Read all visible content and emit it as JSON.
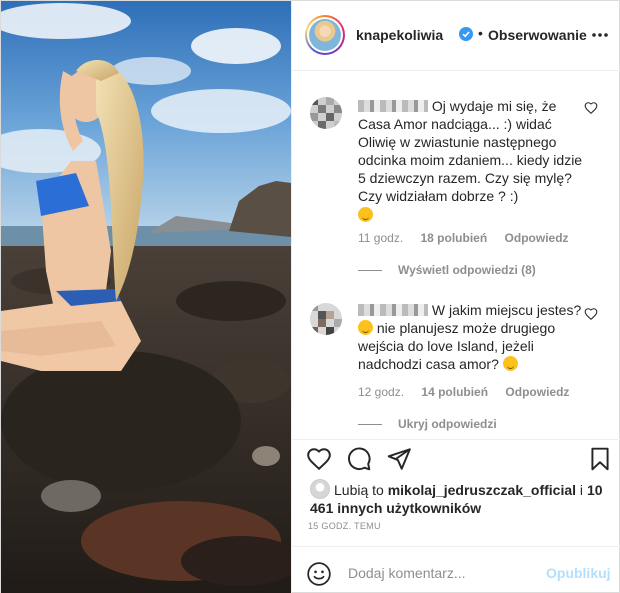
{
  "post": {
    "author": {
      "username": "knapekoliwia",
      "verified": true
    },
    "follow_label": "Obserwowanie",
    "separator": "•"
  },
  "comments": [
    {
      "text": "Oj wydaje mi się, że Casa Amor nadciąga... :) widać Oliwię w zwiastunie następnego odcinka moim zdaniem... kiedy idzie 5 dziewczyn razem. Czy się mylę? Czy widziałam dobrze ? :)",
      "time": "11 godz.",
      "likes": "18 polubień",
      "reply_label": "Odpowiedz",
      "replies_toggle": "Wyświetl odpowiedzi (8)"
    },
    {
      "text": "W jakim miejscu jestes?",
      "text_after_emoji": "nie planujesz może drugiego wejścia do love Island, jeżeli nadchodzi casa amor?",
      "time": "12 godz.",
      "likes": "14 polubień",
      "reply_label": "Odpowiedz",
      "replies_toggle": "Ukryj odpowiedzi"
    }
  ],
  "likes_line": {
    "prefix": "Lubią to",
    "user": "mikolaj_jedruszczak_official",
    "conj": "i",
    "others": "10 461 innych użytkowników"
  },
  "timestamp": "15 GODZ. TEMU",
  "comment_box": {
    "placeholder": "Dodaj komentarz...",
    "post_label": "Opublikuj"
  },
  "icons": [
    "verified-badge-icon",
    "more-icon",
    "heart-icon",
    "comment-icon",
    "share-icon",
    "bookmark-icon",
    "emoji-icon"
  ],
  "colors": {
    "verified": "#3897f0",
    "post_button_disabled": "#b2dffc",
    "muted_text": "#8e8e8e"
  }
}
